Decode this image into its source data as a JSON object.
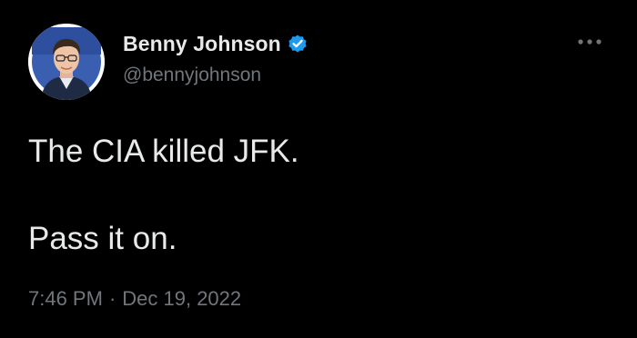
{
  "author": {
    "display_name": "Benny Johnson",
    "handle": "@bennyjohnson",
    "verified": true,
    "verified_badge_icon": "verified-badge-icon",
    "avatar_icon": "avatar-photo"
  },
  "tweet": {
    "text_line_1": "The CIA killed JFK.",
    "text_line_2": "Pass it on."
  },
  "meta": {
    "time": "7:46 PM",
    "separator": "·",
    "date": "Dec 19, 2022"
  },
  "actions": {
    "more_icon": "more-horizontal-icon"
  },
  "colors": {
    "background": "#000000",
    "primary_text": "#e7e9ea",
    "secondary_text": "#71767b",
    "verified_blue": "#1d9bf0"
  }
}
